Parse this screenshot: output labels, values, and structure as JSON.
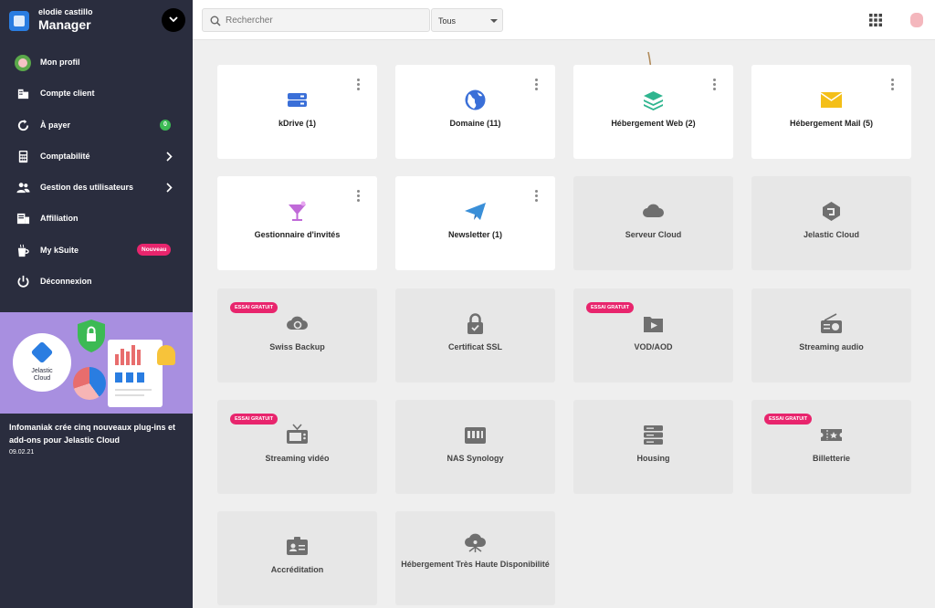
{
  "header": {
    "user_name": "elodie castillo",
    "app_title": "Manager",
    "search_placeholder": "Rechercher",
    "filter_value": "Tous"
  },
  "sidebar": {
    "items": [
      {
        "label": "Mon profil",
        "icon": "profile-avatar-icon"
      },
      {
        "label": "Compte client",
        "icon": "building-icon"
      },
      {
        "label": "À payer",
        "icon": "refresh-icon",
        "badge": "0"
      },
      {
        "label": "Comptabilité",
        "icon": "calculator-icon"
      },
      {
        "label": "Gestion des utilisateurs",
        "icon": "users-icon"
      },
      {
        "label": "Affiliation",
        "icon": "affiliation-icon"
      },
      {
        "label": "My kSuite",
        "icon": "mug-icon",
        "badge": "Nouveau"
      },
      {
        "label": "Déconnexion",
        "icon": "power-icon"
      }
    ],
    "promo": {
      "image_label": "Jelastic\nCloud",
      "title": "Infomaniak crée cinq nouveaux plug-ins et add-ons pour Jelastic Cloud",
      "date": "09.02.21"
    }
  },
  "colors": {
    "sidebar_bg": "#2a2d3e",
    "accent_blue": "#2a7de1",
    "badge_pink": "#e8256d",
    "badge_green": "#3cba54",
    "promo_purple": "#a88fe0"
  },
  "products": [
    {
      "label": "kDrive (1)",
      "icon": "kdrive-icon",
      "active": true,
      "menu": true
    },
    {
      "label": "Domaine (11)",
      "icon": "globe-icon",
      "active": true,
      "menu": true
    },
    {
      "label": "Hébergement Web (2)",
      "icon": "web-hosting-layers-icon",
      "active": true,
      "menu": true
    },
    {
      "label": "Hébergement Mail (5)",
      "icon": "mail-envelope-icon",
      "active": true,
      "menu": true
    },
    {
      "label": "Gestionnaire d'invités",
      "icon": "cocktail-icon",
      "active": true,
      "menu": true
    },
    {
      "label": "Newsletter (1)",
      "icon": "paper-plane-icon",
      "active": true,
      "menu": true
    },
    {
      "label": "Serveur Cloud",
      "icon": "cloud-icon",
      "active": false
    },
    {
      "label": "Jelastic Cloud",
      "icon": "jelastic-cube-icon",
      "active": false
    },
    {
      "label": "Swiss Backup",
      "icon": "backup-cloud-icon",
      "active": false,
      "badge": "ESSAI GRATUIT"
    },
    {
      "label": "Certificat SSL",
      "icon": "padlock-icon",
      "active": false
    },
    {
      "label": "VOD/AOD",
      "icon": "video-folder-icon",
      "active": false,
      "badge": "ESSAI GRATUIT"
    },
    {
      "label": "Streaming audio",
      "icon": "radio-icon",
      "active": false
    },
    {
      "label": "Streaming vidéo",
      "icon": "tv-icon",
      "active": false,
      "badge": "ESSAI GRATUIT"
    },
    {
      "label": "NAS Synology",
      "icon": "nas-icon",
      "active": false
    },
    {
      "label": "Housing",
      "icon": "server-rack-icon",
      "active": false
    },
    {
      "label": "Billetterie",
      "icon": "ticket-icon",
      "active": false,
      "badge": "ESSAI GRATUIT"
    },
    {
      "label": "Accréditation",
      "icon": "id-badge-icon",
      "active": false
    },
    {
      "label": "Hébergement Très Haute Disponibilité",
      "icon": "ha-cloud-icon",
      "active": false
    }
  ]
}
